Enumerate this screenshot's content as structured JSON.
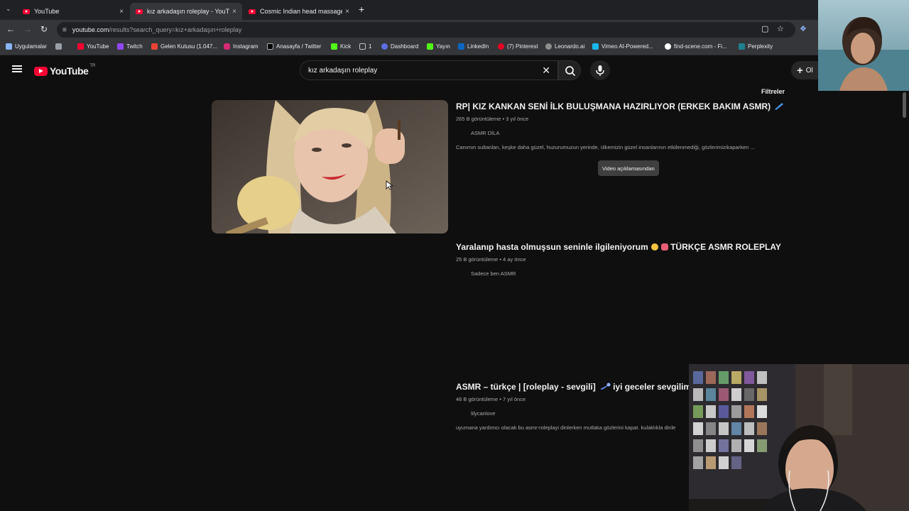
{
  "browser": {
    "tabs": [
      {
        "title": "YouTube",
        "active": false
      },
      {
        "title": "kız arkadaşın roleplay - YouTube",
        "active": true
      },
      {
        "title": "Cosmic Indian head massage",
        "active": false
      }
    ],
    "url_domain": "youtube.com",
    "url_path": "/results?search_query=kız+arkadaşın+roleplay",
    "bookmarks": [
      "Uygulamalar",
      "YouTube",
      "Twitch",
      "Gelen Kutusu (1.047...",
      "Instagram",
      "Anasayfa / Twitter",
      "Kick",
      "1",
      "Dashboard",
      "Yayın",
      "LinkedIn",
      "(7) Pinterest",
      "Leonardo.ai",
      "Vimeo AI-Powered...",
      "find-scene.com - Fi...",
      "Perplexity"
    ]
  },
  "youtube": {
    "logo_text": "YouTube",
    "country_code": "TR",
    "search_query": "kız arkadaşın roleplay",
    "create_label": "Ol",
    "filters_label": "Filtreler"
  },
  "results": [
    {
      "title": "RP| KIZ KANKAN SENİ İLK BULUŞMANA HAZIRLIYOR (ERKEK BAKIM ASMR)",
      "views": "265 B görüntüleme",
      "age": "3 yıl önce",
      "channel": "ASMR DİLA",
      "description": "Canımın sultanları, keşke daha güzel, huzurumuzun yerinde, ülkemizin güzel insanlarının etkilenmediği, gözlerimizikaparken ...",
      "chip": "Video açıklamasından"
    },
    {
      "title": "Yaralanıp hasta olmuşsun seninle ilgileniyorum",
      "title_suffix": "TÜRKÇE ASMR ROLEPLAY",
      "views": "25 B görüntüleme",
      "age": "4 ay önce",
      "channel": "Sadece ben ASMR"
    },
    {
      "title": "ASMR – türkçe | [roleplay - sevgili]",
      "title_suffix": "iyi geceler sevgilim",
      "views": "46 B görüntüleme",
      "age": "7 yıl önce",
      "channel": "lilycanlove",
      "description": "uyumana yardımcı olacak bu asmr-roleplayi dinlerken mutlaka gözlerini kapat. kulaklıkla dinle"
    }
  ],
  "icons": {
    "tab_close": "×",
    "new_tab": "+",
    "back": "←",
    "forward": "→",
    "reload": "↻",
    "star": "☆",
    "meta_sep": "•"
  },
  "colors": {
    "yt_red": "#ff0033",
    "bg": "#0f0f0f",
    "meta": "#aaaaaa"
  }
}
